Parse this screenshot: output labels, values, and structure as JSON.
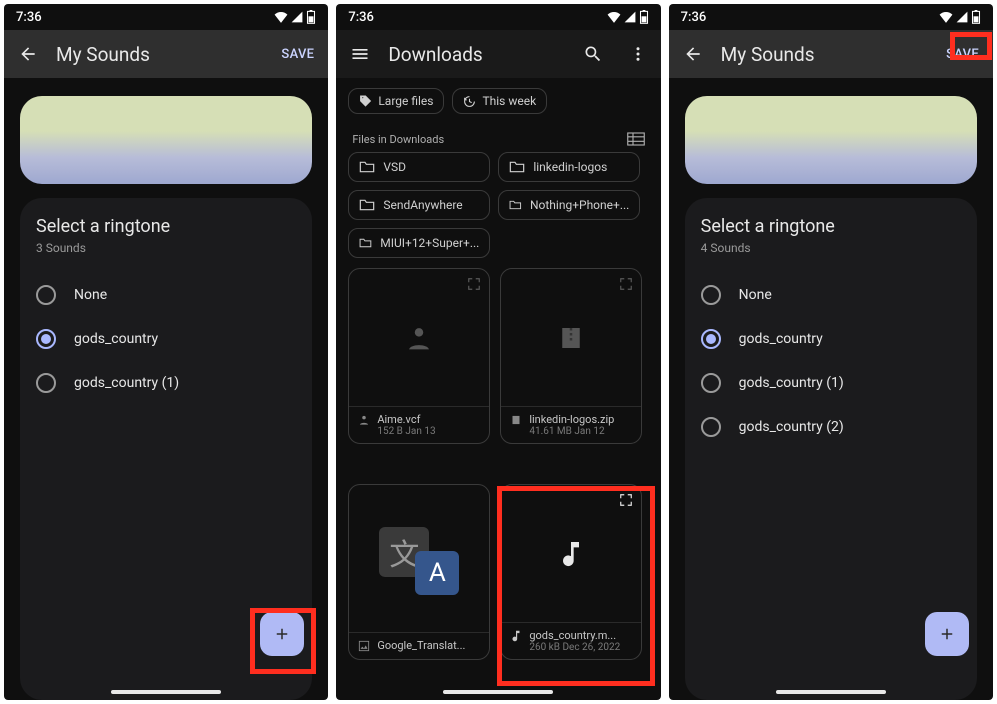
{
  "status_time": "7:36",
  "screen1": {
    "title": "My Sounds",
    "save": "SAVE",
    "section_title": "Select a ringtone",
    "count": "3 Sounds",
    "items": [
      "None",
      "gods_country",
      "gods_country (1)"
    ],
    "selected_index": 1
  },
  "screen2": {
    "title": "Downloads",
    "chips": [
      "Large files",
      "This week"
    ],
    "files_header": "Files in Downloads",
    "folders": [
      "VSD",
      "linkedin-logos",
      "SendAnywhere",
      "Nothing+Phone+...",
      "MIUI+12+Super+..."
    ],
    "files": [
      {
        "name": "Aime.vcf",
        "sub": "152 B Jan 13",
        "type": "contact"
      },
      {
        "name": "linkedin-logos.zip",
        "sub": "41.61 MB Jan 12",
        "type": "zip"
      },
      {
        "name": "Google_Translat...",
        "sub": "",
        "type": "translate"
      },
      {
        "name": "gods_country.m...",
        "sub": "260 kB Dec 26, 2022",
        "type": "audio"
      }
    ]
  },
  "screen3": {
    "title": "My Sounds",
    "save": "SAVE",
    "section_title": "Select a ringtone",
    "count": "4 Sounds",
    "items": [
      "None",
      "gods_country",
      "gods_country (1)",
      "gods_country (2)"
    ],
    "selected_index": 1
  }
}
